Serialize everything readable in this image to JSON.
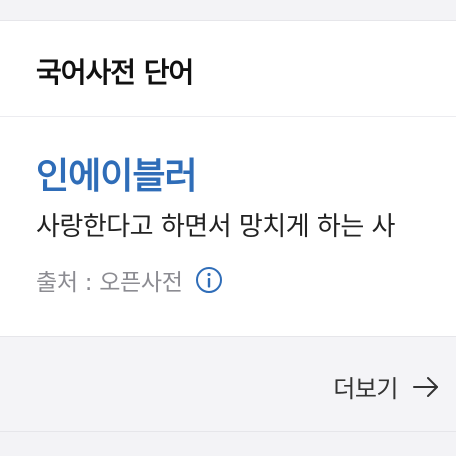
{
  "card": {
    "title": "국어사전 단어"
  },
  "entry": {
    "word": "인에이블러",
    "definition": "사랑한다고 하면서 망치게 하는 사",
    "source": "출처 : 오픈사전"
  },
  "more": {
    "label": "더보기"
  },
  "colors": {
    "accent": "#2f6db8",
    "background": "#f3f3f6"
  },
  "icons": {
    "info": "info-icon",
    "more": "arrow-right-icon"
  }
}
